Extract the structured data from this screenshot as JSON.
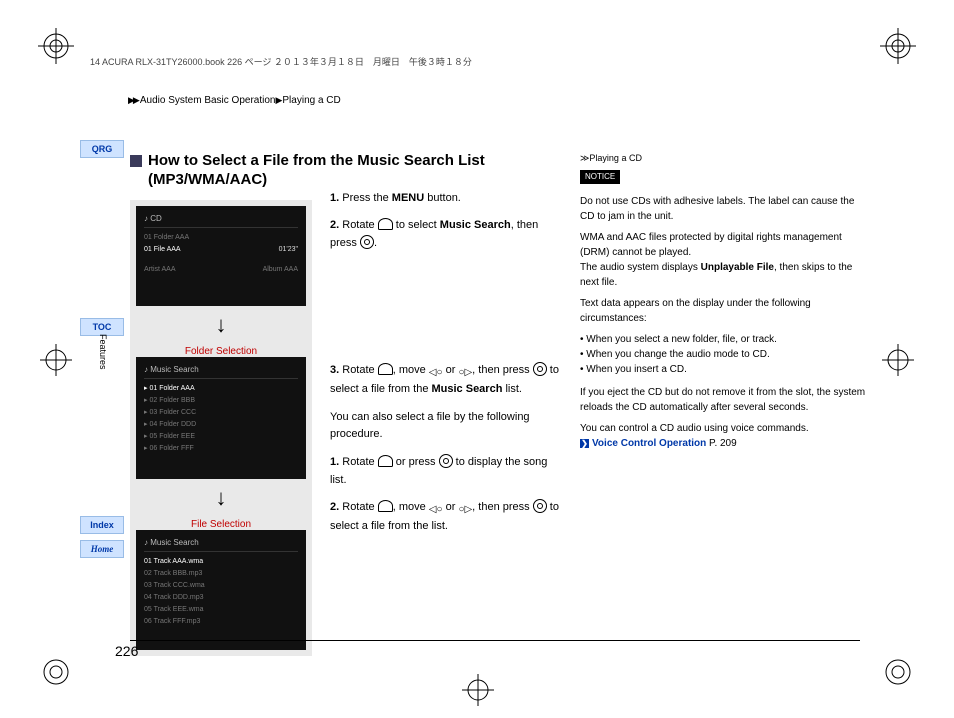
{
  "header": {
    "bookline": "14 ACURA RLX-31TY26000.book  226 ページ  ２０１３年３月１８日　月曜日　午後３時１８分",
    "breadcrumb1": "Audio System Basic Operation",
    "breadcrumb2": "Playing a CD"
  },
  "tabs": {
    "qrg": "QRG",
    "toc": "TOC",
    "index": "Index",
    "home": "Home",
    "features": "Features"
  },
  "title": {
    "line1": "How to Select a File from the Music Search List",
    "line2": "(MP3/WMA/AAC)"
  },
  "screenshots": {
    "folder_caption": "Folder Selection",
    "file_caption": "File Selection",
    "cd_header": "♪   CD",
    "ms_header": "♪  Music Search",
    "s1": {
      "l1": "01  Folder AAA",
      "l2": "01 File AAA",
      "l2_time": "01'23\"",
      "l3a": "Artist AAA",
      "l3b": "Album AAA"
    },
    "s2": {
      "i1": "01 Folder AAA",
      "i2": "02 Folder BBB",
      "i3": "03 Folder CCC",
      "i4": "04 Folder DDD",
      "i5": "05 Folder EEE",
      "i6": "06 Folder FFF"
    },
    "s3": {
      "i1": "01 Track AAA.wma",
      "i2": "02 Track BBB.mp3",
      "i3": "03 Track CCC.wma",
      "i4": "04 Track DDD.mp3",
      "i5": "05 Track EEE.wma",
      "i6": "06 Track FFF.mp3"
    }
  },
  "steps": {
    "s1a": "1.",
    "s1b": "Press the ",
    "s1c": "MENU",
    "s1d": " button.",
    "s2a": "2.",
    "s2b": "Rotate ",
    "s2c": " to select ",
    "s2d": "Music Search",
    "s2e": ", then press ",
    "s2f": ".",
    "s3a": "3.",
    "s3b": "Rotate ",
    "s3c": ", move ",
    "s3d": " or ",
    "s3e": ", then press ",
    "s3f": " to select a file from the ",
    "s3g": "Music Search",
    "s3h": " list.",
    "alt_intro": "You can also select a file by the following procedure.",
    "a1a": "1.",
    "a1b": "Rotate ",
    "a1c": " or press ",
    "a1d": " to display the song  list.",
    "a2a": "2.",
    "a2b": "Rotate ",
    "a2c": ", move ",
    "a2d": " or ",
    "a2e": ", then press ",
    "a2f": " to select a file from the list."
  },
  "notes": {
    "head_prefix": "≫",
    "head": "Playing a CD",
    "notice": "NOTICE",
    "n1": "Do not use CDs with adhesive labels. The label can cause the CD to jam in the unit.",
    "n2a": "WMA and AAC files protected by digital rights management (DRM) cannot be played.",
    "n2b": "The audio system displays ",
    "n2bold": "Unplayable File",
    "n2c": ", then skips to the next file.",
    "n3": "Text data appears on the display under the following circumstances:",
    "b1": "When you select a new folder, file, or track.",
    "b2": "When you change the audio mode to CD.",
    "b3": "When you insert a CD.",
    "n4": "If you eject the CD but do not remove it from the slot, the system reloads the CD automatically after several seconds.",
    "n5": "You can control a CD audio using voice commands.",
    "link_text": "Voice Control Operation",
    "link_page": " P. 209"
  },
  "pagenum": "226"
}
